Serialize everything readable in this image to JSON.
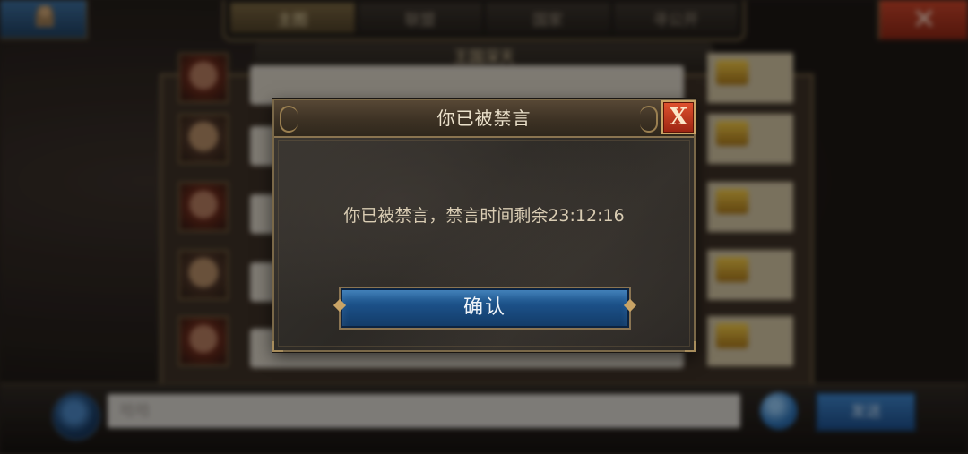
{
  "background": {
    "tabs": [
      {
        "label": "主图",
        "active": true
      },
      {
        "label": "联盟",
        "active": false
      },
      {
        "label": "国家",
        "active": false
      },
      {
        "label": "寻公开",
        "active": false
      }
    ],
    "channel_title": "王国深天",
    "input_placeholder": "哈哈",
    "send_label": "发送",
    "close_glyph": "✕"
  },
  "dialog": {
    "title": "你已被禁言",
    "close_glyph": "X",
    "message": "你已被禁言，禁言时间剩余23:12:16",
    "confirm_label": "确认"
  },
  "colors": {
    "dialog_title": "#ebe1cb",
    "message_text": "#d9ccb3",
    "confirm_button": "#1b4f86",
    "close_button": "#d2472a",
    "frame_gold": "#8a7450"
  }
}
